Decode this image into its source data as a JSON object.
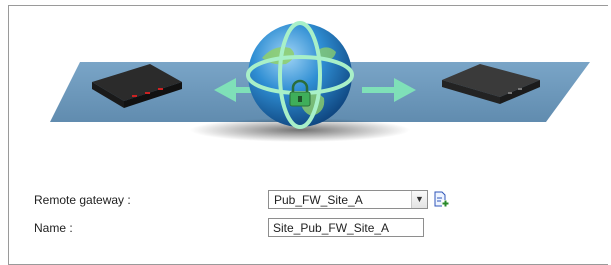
{
  "form": {
    "remote_gateway_label": "Remote gateway :",
    "remote_gateway_value": "Pub_FW_Site_A",
    "name_label": "Name :",
    "name_value": "Site_Pub_FW_Site_A"
  },
  "icons": {
    "dropdown": "chevron-down-icon",
    "add": "add-object-icon",
    "globe": "globe-icon",
    "lock": "lock-icon"
  },
  "colors": {
    "plane": "#5f8fb5",
    "arrow": "#7fe0b8",
    "globe": "#2a7fc2"
  }
}
